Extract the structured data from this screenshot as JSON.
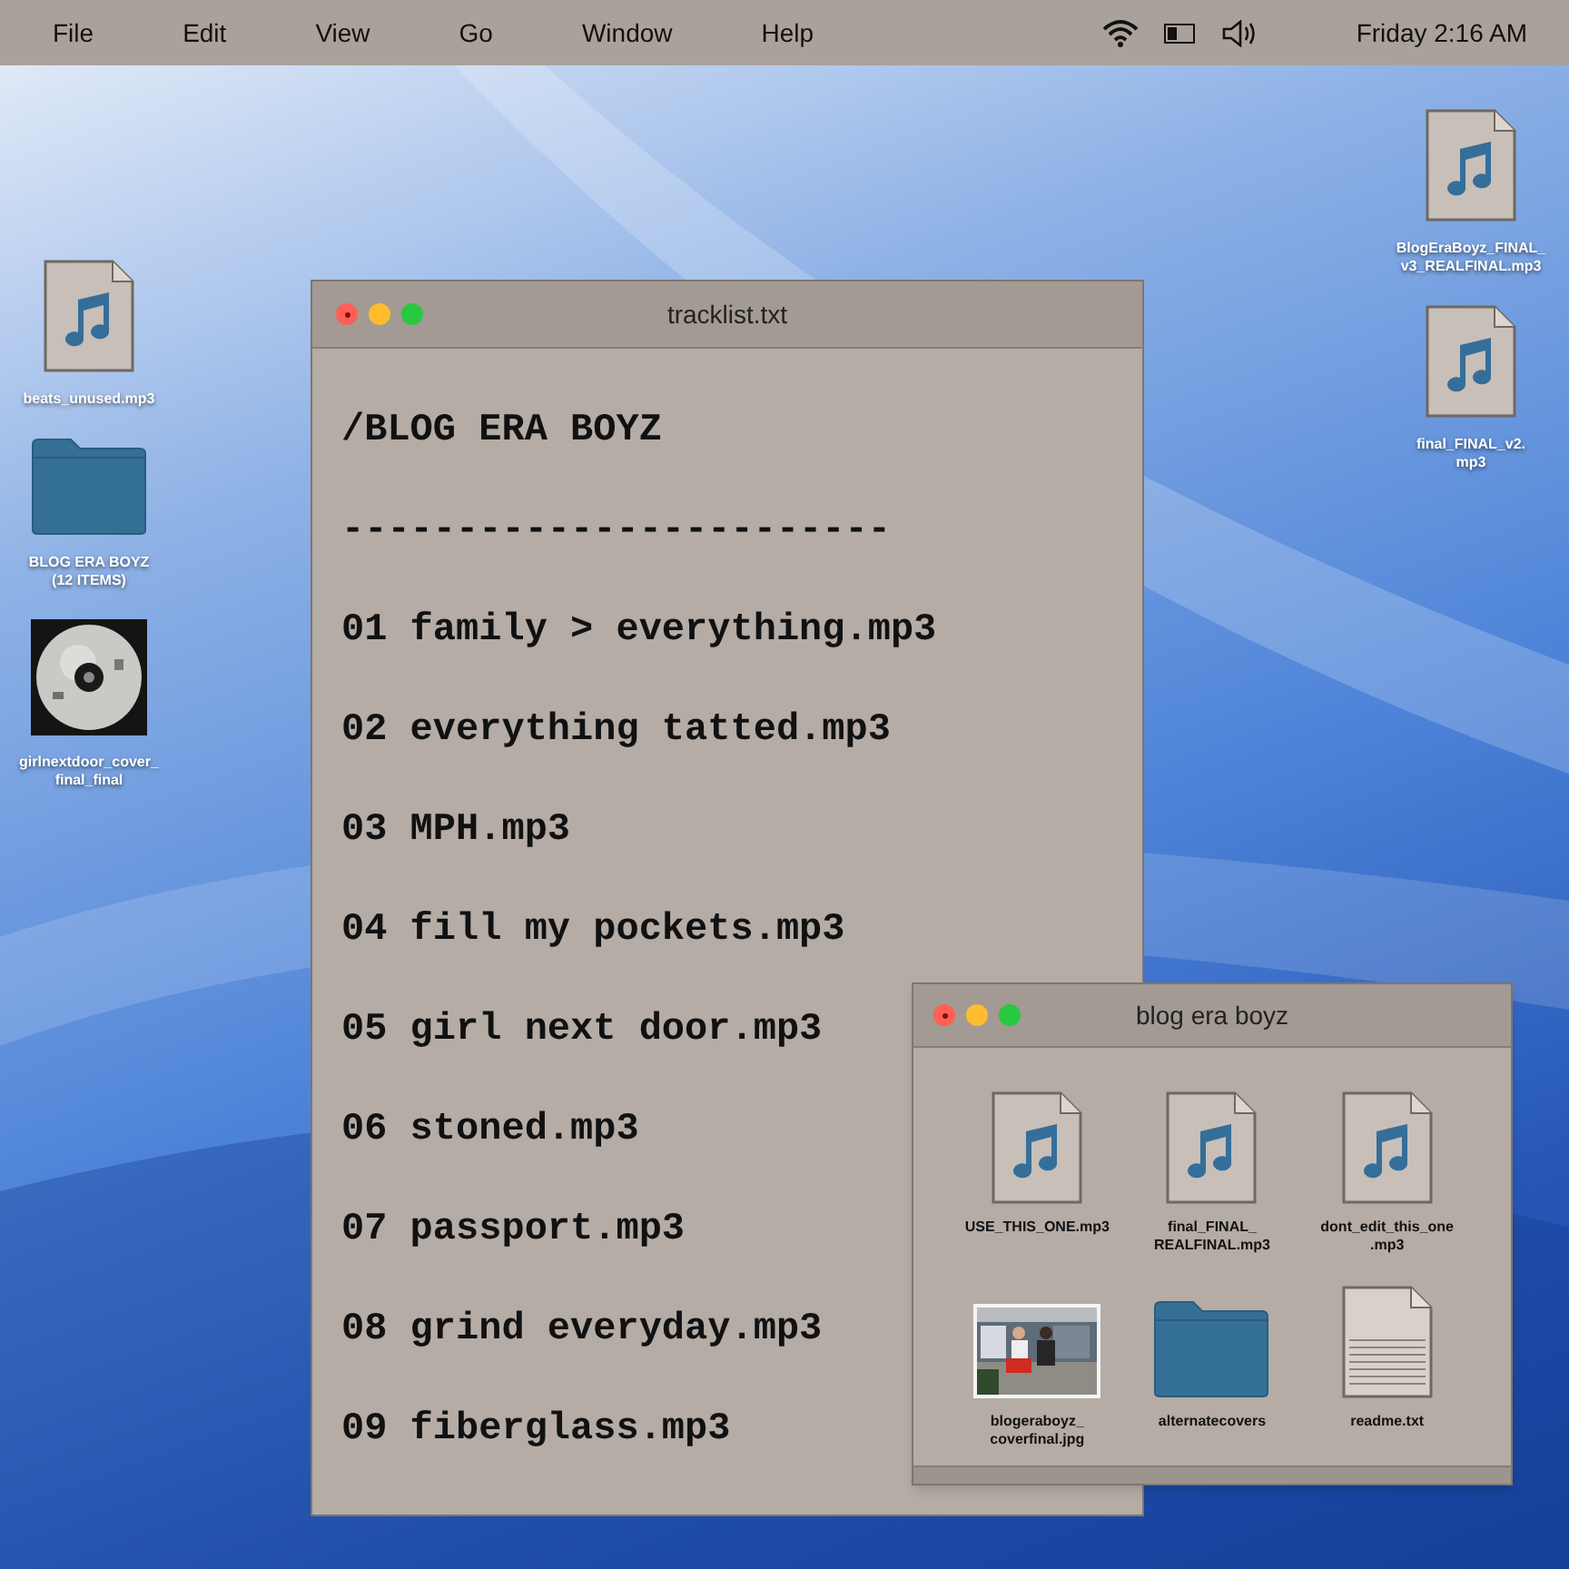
{
  "menu_bar": {
    "menus": [
      "File",
      "Edit",
      "View",
      "Go",
      "Window",
      "Help"
    ],
    "clock": "Friday 2:16 AM"
  },
  "desktop_left": [
    {
      "kind": "audio",
      "label": [
        "beats_unused.mp3"
      ]
    },
    {
      "kind": "folder",
      "label": [
        "BLOG ERA BOYZ",
        "(12 ITEMS)"
      ]
    },
    {
      "kind": "picture",
      "label": [
        "girlnextdoor_cover_",
        "final_final"
      ]
    }
  ],
  "desktop_right": [
    {
      "kind": "audio",
      "label": [
        "BlogEraBoyz_FINAL_",
        "v3_REALFINAL.mp3"
      ]
    },
    {
      "kind": "audio",
      "label": [
        "final_FINAL_v2.",
        "mp3"
      ]
    }
  ],
  "text_window": {
    "title": "tracklist.txt",
    "lines": [
      "/BLOG ERA BOYZ",
      "------------------------",
      "01 family > everything.mp3",
      "02 everything tatted.mp3",
      "03 MPH.mp3",
      "04 fill my pockets.mp3",
      "05 girl next door.mp3",
      "06 stoned.mp3",
      "07 passport.mp3",
      "08 grind everyday.mp3",
      "09 fiberglass.mp3"
    ]
  },
  "folder_window": {
    "title": "blog era boyz",
    "items": [
      {
        "kind": "audio",
        "label": [
          "USE_THIS_ONE.mp3"
        ]
      },
      {
        "kind": "audio",
        "label": [
          "final_FINAL_",
          "REALFINAL.mp3"
        ]
      },
      {
        "kind": "audio",
        "label": [
          "dont_edit_this_one",
          ".mp3"
        ]
      },
      {
        "kind": "picture",
        "label": [
          "blogeraboyz_",
          "coverfinal.jpg"
        ]
      },
      {
        "kind": "folder",
        "label": [
          "alternatecovers"
        ]
      },
      {
        "kind": "text",
        "label": [
          "readme.txt"
        ]
      }
    ]
  }
}
